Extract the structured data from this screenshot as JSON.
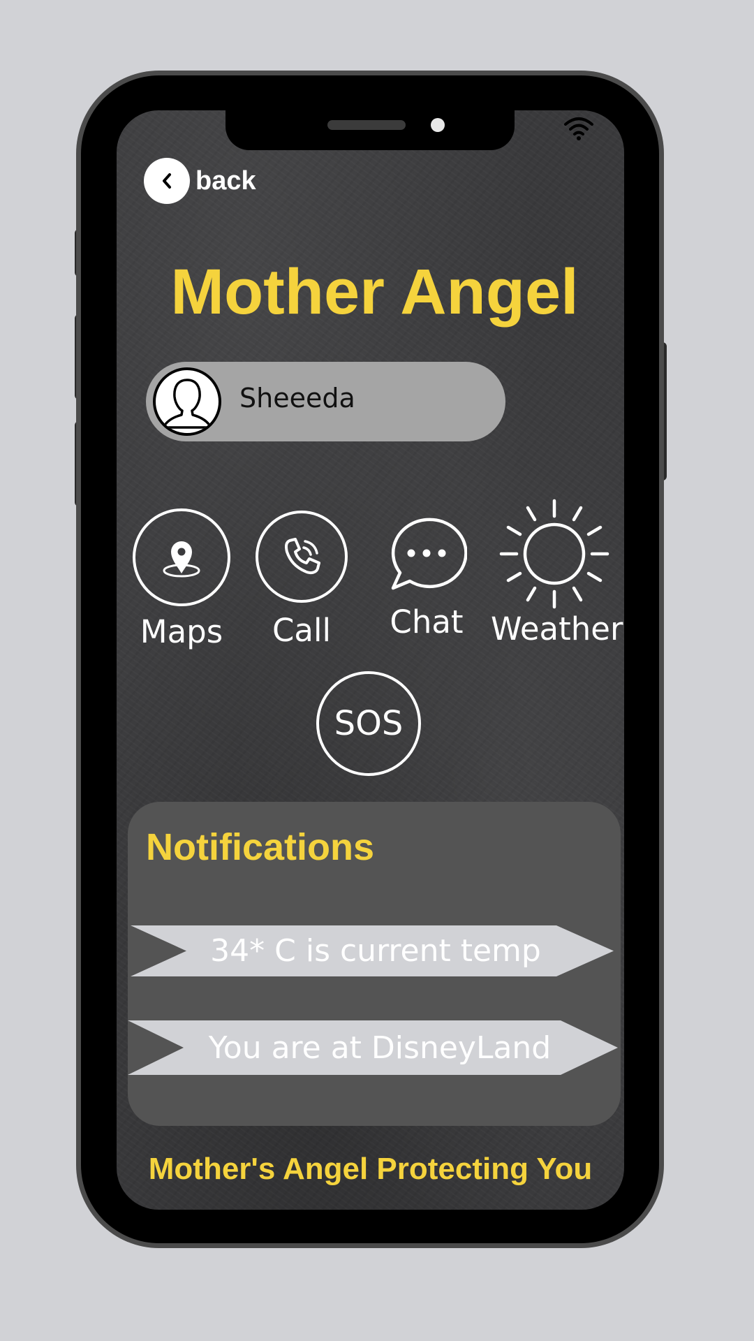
{
  "header": {
    "back_label": "back"
  },
  "app": {
    "title": "Mother Angel"
  },
  "user": {
    "name": "Sheeeda"
  },
  "actions": [
    {
      "label": "Maps",
      "icon": "map-pin-icon"
    },
    {
      "label": "Call",
      "icon": "phone-icon"
    },
    {
      "label": "Chat",
      "icon": "chat-bubble-icon"
    },
    {
      "label": "Weather",
      "icon": "sun-icon"
    }
  ],
  "sos": {
    "label": "SOS"
  },
  "notifications": {
    "title": "Notifications",
    "items": [
      "34* C is current temp",
      "You are at DisneyLand"
    ]
  },
  "footer": {
    "tagline": "Mother's Angel Protecting You"
  },
  "colors": {
    "accent": "#f5d33d",
    "background": "#3a3a3c",
    "panel": "#545454",
    "pill": "#a5a5a5"
  }
}
